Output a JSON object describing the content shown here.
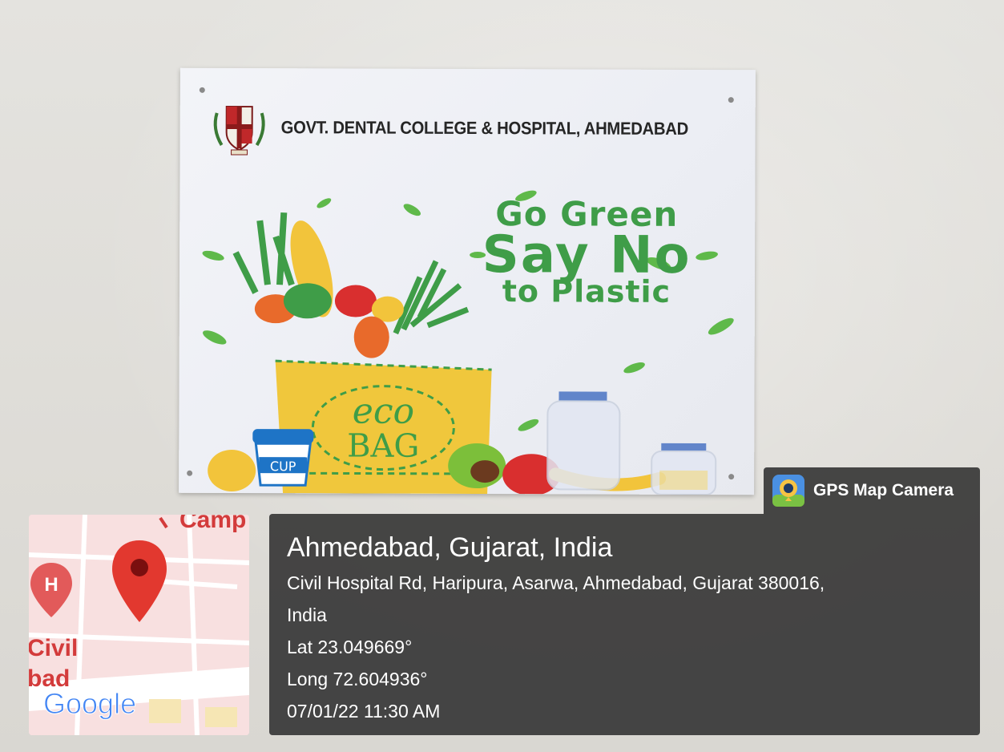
{
  "poster": {
    "institution": "GOVT. DENTAL COLLEGE & HOSPITAL, AHMEDABAD",
    "slogan_line1": "Go Green",
    "slogan_line2": "Say No",
    "slogan_line3": "to Plastic",
    "bag_label_line1": "eco",
    "bag_label_line2": "BAG",
    "cup_label": "CUP"
  },
  "map": {
    "place_label_top": "Camp",
    "place_label_left1": "Civil",
    "place_label_left2": "bad",
    "hospital_marker_letter": "H",
    "provider": "Google"
  },
  "overlay": {
    "app_name": "GPS Map Camera",
    "city": "Ahmedabad, Gujarat, India",
    "address_line1": "Civil Hospital Rd, Haripura, Asarwa, Ahmedabad, Gujarat 380016,",
    "address_line2": "India",
    "latitude": "Lat 23.049669°",
    "longitude": "Long 72.604936°",
    "datetime": "07/01/22 11:30 AM"
  },
  "colors": {
    "slogan_green": "#3f9d48",
    "overlay_bg": "#373737",
    "pin_red": "#e2382f"
  }
}
